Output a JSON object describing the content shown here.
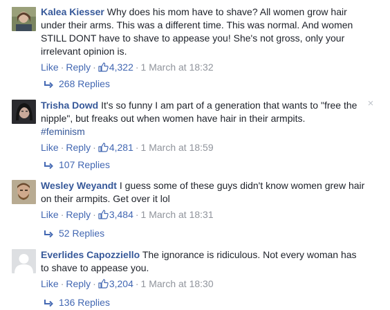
{
  "comments": [
    {
      "author": "Kalea Kiesser",
      "text": "Why does his mom have to shave? All women grow hair under their arms. This was a different time. This was normal. And women STILL DONT have to shave to appease you! She's not gross, only your irrelevant opinion is.",
      "tag": "",
      "like_label": "Like",
      "reply_label": "Reply",
      "likes": "4,322",
      "timestamp": "1 March at 18:32",
      "replies": "268 Replies",
      "avatar_icon": "profile-photo"
    },
    {
      "author": "Trisha Dowd",
      "text": "It's so funny I am part of a generation that wants to \"free the nipple\", but freaks out when women have hair in their armpits.",
      "tag": "#feminism",
      "like_label": "Like",
      "reply_label": "Reply",
      "likes": "4,281",
      "timestamp": "1 March at 18:59",
      "replies": "107 Replies",
      "avatar_icon": "profile-photo"
    },
    {
      "author": "Wesley Weyandt",
      "text": "I guess some of these guys didn't know women grew hair on their armpits. Get over it lol",
      "tag": "",
      "like_label": "Like",
      "reply_label": "Reply",
      "likes": "3,484",
      "timestamp": "1 March at 18:31",
      "replies": "52 Replies",
      "avatar_icon": "profile-photo"
    },
    {
      "author": "Everlides Capozziello",
      "text": "The ignorance is ridiculous. Not every woman has to shave to appease you.",
      "tag": "",
      "like_label": "Like",
      "reply_label": "Reply",
      "likes": "3,204",
      "timestamp": "1 March at 18:30",
      "replies": "136 Replies",
      "avatar_icon": "default-avatar"
    }
  ],
  "close_symbol": "×",
  "separator": "·",
  "colors": {
    "link": "#4267b2",
    "author": "#365899",
    "meta": "#90949c",
    "text": "#1d2129"
  }
}
